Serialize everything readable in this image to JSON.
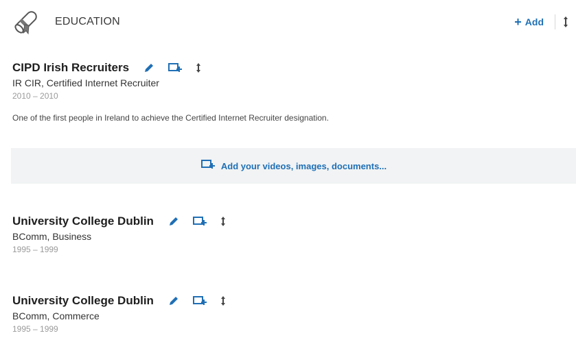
{
  "section": {
    "title": "EDUCATION",
    "add_label": "Add",
    "icon": "diploma-icon"
  },
  "entries": [
    {
      "school": "CIPD Irish Recruiters",
      "degree": "IR CIR, Certified Internet Recruiter",
      "dates": "2010 – 2010",
      "description": "One of the first people in Ireland to achieve the Certified Internet Recruiter designation."
    },
    {
      "school": "University College Dublin",
      "degree": "BComm, Business",
      "dates": "1995 – 1999"
    },
    {
      "school": "University College Dublin",
      "degree": "BComm, Commerce",
      "dates": "1995 – 1999"
    }
  ],
  "media_bar": {
    "label": "Add your videos, images, documents..."
  },
  "colors": {
    "accent": "#1f6fb5",
    "muted": "#9a9a9a",
    "media_bg": "#f1f3f4"
  }
}
